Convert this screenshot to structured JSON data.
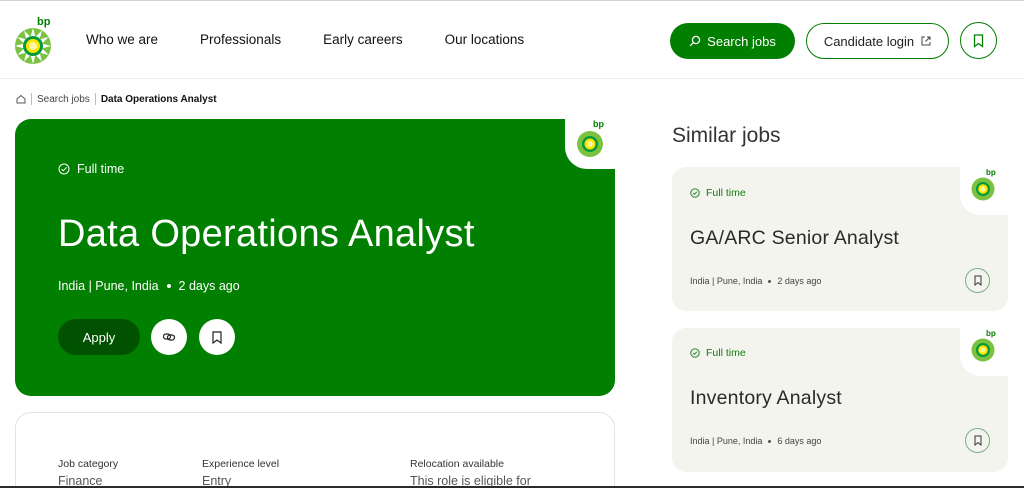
{
  "header": {
    "nav": [
      "Who we are",
      "Professionals",
      "Early careers",
      "Our locations"
    ],
    "search_label": "Search jobs",
    "login_label": "Candidate login",
    "logo_text": "bp"
  },
  "breadcrumb": {
    "items": [
      "Search jobs",
      "Data Operations Analyst"
    ]
  },
  "job": {
    "type": "Full time",
    "title": "Data Operations Analyst",
    "location": "India | Pune, India",
    "posted": "2 days ago",
    "apply_label": "Apply"
  },
  "details": {
    "fields": [
      {
        "label": "Job category",
        "value": "Finance"
      },
      {
        "label": "Experience level",
        "value": "Entry"
      },
      {
        "label": "Relocation available",
        "value": "This role is eligible for"
      }
    ]
  },
  "similar": {
    "title": "Similar jobs",
    "jobs": [
      {
        "type": "Full time",
        "title": "GA/ARC Senior Analyst",
        "location": "India | Pune, India",
        "posted": "2 days ago"
      },
      {
        "type": "Full time",
        "title": "Inventory Analyst",
        "location": "India | Pune, India",
        "posted": "6 days ago"
      }
    ]
  },
  "colors": {
    "brand_green": "#007f00",
    "apply_dark": "#005100",
    "card_bg": "#f3f4ed"
  }
}
